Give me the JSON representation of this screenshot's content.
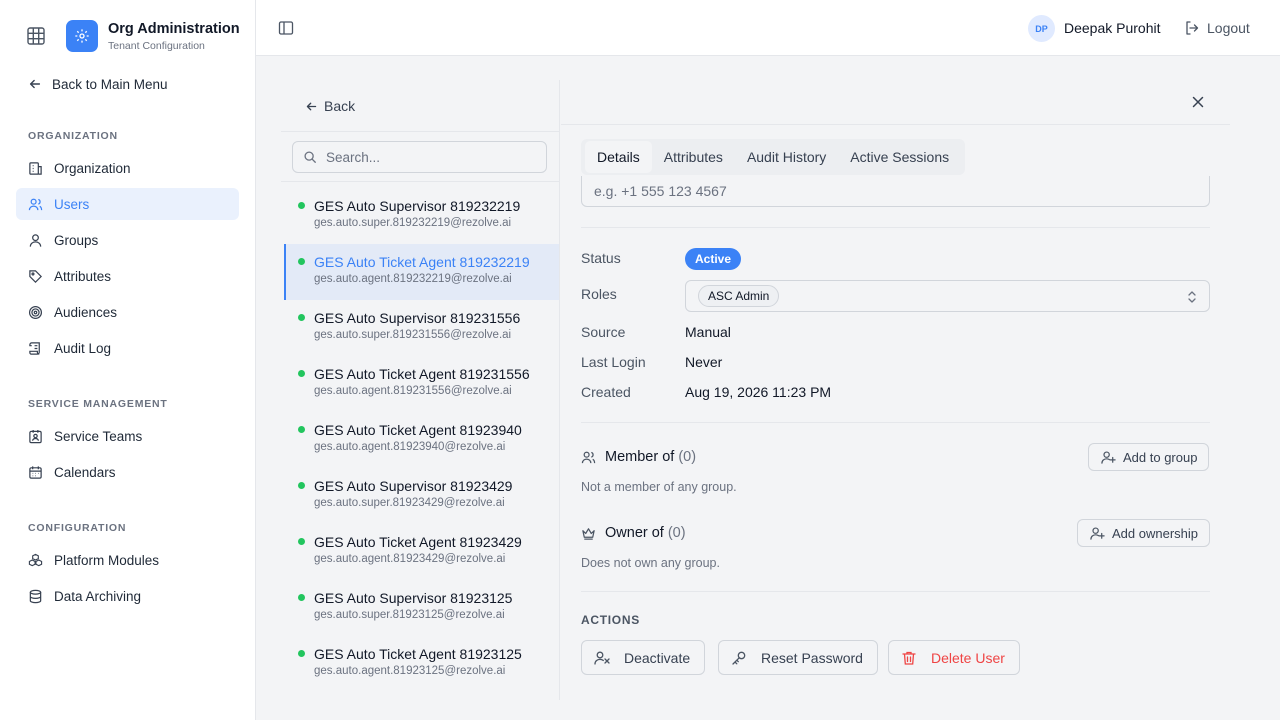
{
  "sidebar": {
    "brand_title": "Org Administration",
    "brand_subtitle": "Tenant Configuration",
    "back_label": "Back to Main Menu",
    "sections": {
      "organization": "ORGANIZATION",
      "service_management": "SERVICE MANAGEMENT",
      "configuration": "CONFIGURATION"
    },
    "items": {
      "organization": "Organization",
      "users": "Users",
      "groups": "Groups",
      "attributes": "Attributes",
      "audiences": "Audiences",
      "audit_log": "Audit Log",
      "service_teams": "Service Teams",
      "calendars": "Calendars",
      "platform_modules": "Platform Modules",
      "data_archiving": "Data Archiving"
    },
    "active_item": "users",
    "icons": [
      "grid-icon",
      "gear-icon",
      "arrow-left-icon",
      "building-icon",
      "users-icon",
      "user-icon",
      "tag-icon",
      "target-icon",
      "scroll-icon",
      "contact-icon",
      "calendar-icon",
      "boxes-icon",
      "database-icon"
    ]
  },
  "header": {
    "user_initials": "DP",
    "user_name": "Deepak Purohit",
    "logout_label": "Logout"
  },
  "user_list": {
    "back_label": "Back",
    "search_placeholder": "Search...",
    "selected_index": 1,
    "users": [
      {
        "name": "GES Auto Supervisor 819232219",
        "email": "ges.auto.super.819232219@rezolve.ai"
      },
      {
        "name": "GES Auto Ticket Agent 819232219",
        "email": "ges.auto.agent.819232219@rezolve.ai"
      },
      {
        "name": "GES Auto Supervisor 819231556",
        "email": "ges.auto.super.819231556@rezolve.ai"
      },
      {
        "name": "GES Auto Ticket Agent 819231556",
        "email": "ges.auto.agent.819231556@rezolve.ai"
      },
      {
        "name": "GES Auto Ticket Agent 81923940",
        "email": "ges.auto.agent.81923940@rezolve.ai"
      },
      {
        "name": "GES Auto Supervisor 81923429",
        "email": "ges.auto.super.81923429@rezolve.ai"
      },
      {
        "name": "GES Auto Ticket Agent 81923429",
        "email": "ges.auto.agent.81923429@rezolve.ai"
      },
      {
        "name": "GES Auto Supervisor 81923125",
        "email": "ges.auto.super.81923125@rezolve.ai"
      },
      {
        "name": "GES Auto Ticket Agent 81923125",
        "email": "ges.auto.agent.81923125@rezolve.ai"
      }
    ],
    "status_color": "#22c55e"
  },
  "detail": {
    "tabs": {
      "details": "Details",
      "attributes": "Attributes",
      "audit_history": "Audit History",
      "active_sessions": "Active Sessions"
    },
    "active_tab": "details",
    "phone_placeholder": "e.g. +1 555 123 4567",
    "labels": {
      "status": "Status",
      "roles": "Roles",
      "source": "Source",
      "last_login": "Last Login",
      "created": "Created"
    },
    "values": {
      "status": "Active",
      "role": "ASC Admin",
      "source": "Manual",
      "last_login": "Never",
      "created": "Aug 19, 2026 11:23 PM"
    },
    "member_of": {
      "title": "Member of",
      "count": "(0)",
      "note": "Not a member of any group.",
      "button": "Add to group"
    },
    "owner_of": {
      "title": "Owner of",
      "count": "(0)",
      "note": "Does not own any group.",
      "button": "Add ownership"
    },
    "actions": {
      "label": "ACTIONS",
      "deactivate": "Deactivate",
      "reset_password": "Reset Password",
      "delete_user": "Delete User"
    }
  },
  "colors": {
    "accent": "#3b82f6",
    "danger": "#ef4444",
    "active_status": "#22c55e"
  }
}
